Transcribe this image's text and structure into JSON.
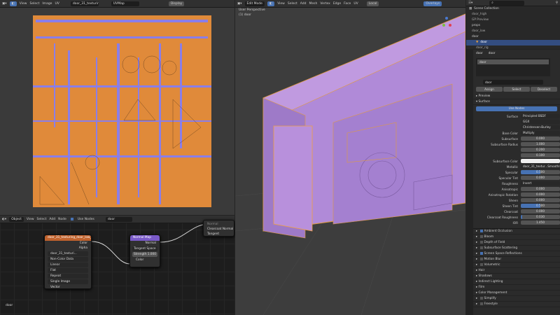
{
  "uv_editor": {
    "menus": [
      "View",
      "Select",
      "Image",
      "UV"
    ],
    "image_name": "door_31_texturing_...",
    "uvmap": "UVMap",
    "display": "Display"
  },
  "node_editor": {
    "object": "Object",
    "menus": [
      "View",
      "Select",
      "Add",
      "Node"
    ],
    "use_nodes": "Use Nodes",
    "material": "door",
    "footer": "door",
    "image_node": {
      "title": "door_31_texturing_door_low_Normal...",
      "outputs": [
        "Color",
        "Alpha"
      ],
      "image": "door_31_texturi...",
      "options": [
        "Non-Color Data",
        "Linear",
        "Flat",
        "Repeat",
        "Single Image"
      ],
      "input": "Vector"
    },
    "normal_map": {
      "title": "Normal Map",
      "output": "Normal",
      "space": "Tangent Space",
      "strength_label": "Strength",
      "strength": "1.000",
      "input": "Color"
    },
    "bsdf_partial": {
      "inputs": [
        "Normal",
        "Clearcoat Normal",
        "Tangent"
      ]
    }
  },
  "viewport": {
    "mode": "Edit Mode",
    "menus": [
      "View",
      "Select",
      "Add",
      "Mesh",
      "Vertex",
      "Edge",
      "Face",
      "UV"
    ],
    "pivot": "Local",
    "overlays": "Overlays",
    "view_name": "User Perspective",
    "object": "(1) door"
  },
  "outliner": {
    "root": "Scene Collection",
    "items": [
      {
        "name": "door_high"
      },
      {
        "name": "GP Preview"
      },
      {
        "name": "props"
      },
      {
        "name": "door_low"
      },
      {
        "name": "door"
      },
      {
        "name": "door",
        "selected": true
      },
      {
        "name": "door_rig"
      }
    ]
  },
  "properties": {
    "object": "door",
    "material": "door",
    "slot": "door",
    "material_field": "door",
    "assign": "Assign",
    "select": "Select",
    "deselect": "Deselect",
    "preview": "Preview",
    "surface_panel": "Surface",
    "use_nodes": "Use Nodes",
    "rows": [
      {
        "label": "Surface",
        "value": "Principled BSDF",
        "type": "menu"
      },
      {
        "label": "",
        "value": "GGX",
        "type": "menu"
      },
      {
        "label": "",
        "value": "Christensen-Burley",
        "type": "menu"
      },
      {
        "label": "Base Color",
        "value": "Multiply",
        "type": "menu"
      },
      {
        "label": "Subsurface",
        "value": "0.000",
        "type": "num",
        "fill": 0
      },
      {
        "label": "Subsurface Radius",
        "value": "1.000",
        "type": "num",
        "fill": 0
      },
      {
        "label": "",
        "value": "0.200",
        "type": "num",
        "fill": 0
      },
      {
        "label": "",
        "value": "0.100",
        "type": "num",
        "fill": 0
      },
      {
        "label": "Subsurface Color",
        "value": "",
        "type": "color"
      },
      {
        "label": "Metallic",
        "value": "door_31_textur...Smoothness.png",
        "type": "menu"
      },
      {
        "label": "Specular",
        "value": "0.500",
        "type": "num",
        "fill": 0.5
      },
      {
        "label": "Specular Tint",
        "value": "0.000",
        "type": "num",
        "fill": 0
      },
      {
        "label": "Roughness",
        "value": "Invert",
        "type": "menu"
      },
      {
        "label": "Anisotropic",
        "value": "0.000",
        "type": "num",
        "fill": 0
      },
      {
        "label": "Anisotropic Rotation",
        "value": "0.000",
        "type": "num",
        "fill": 0
      },
      {
        "label": "Sheen",
        "value": "0.000",
        "type": "num",
        "fill": 0
      },
      {
        "label": "Sheen Tint",
        "value": "0.500",
        "type": "num",
        "fill": 0.5
      },
      {
        "label": "Clearcoat",
        "value": "0.000",
        "type": "num",
        "fill": 0
      },
      {
        "label": "Clearcoat Roughness",
        "value": "0.030",
        "type": "num",
        "fill": 0.03
      },
      {
        "label": "IOR",
        "value": "1.450",
        "type": "num",
        "fill": 0
      }
    ],
    "render_panels": [
      {
        "label": "Ambient Occlusion",
        "check": true
      },
      {
        "label": "Bloom",
        "check": false
      },
      {
        "label": "Depth of Field",
        "check": false
      },
      {
        "label": "Subsurface Scattering",
        "check": false
      },
      {
        "label": "Screen Space Reflections",
        "check": true
      },
      {
        "label": "Motion Blur",
        "check": false
      },
      {
        "label": "Volumetric",
        "check": false
      },
      {
        "label": "Hair"
      },
      {
        "label": "Shadows"
      },
      {
        "label": "Indirect Lighting"
      },
      {
        "label": "Film"
      },
      {
        "label": "Color Management"
      },
      {
        "label": "Simplify",
        "check": false
      },
      {
        "label": "Freestyle",
        "check": false
      }
    ]
  },
  "colors": {
    "accent": "#4772b3",
    "uv_orange": "#e08a3a",
    "uv_purple": "#8a7ee8",
    "mesh": "#b08ad8"
  }
}
